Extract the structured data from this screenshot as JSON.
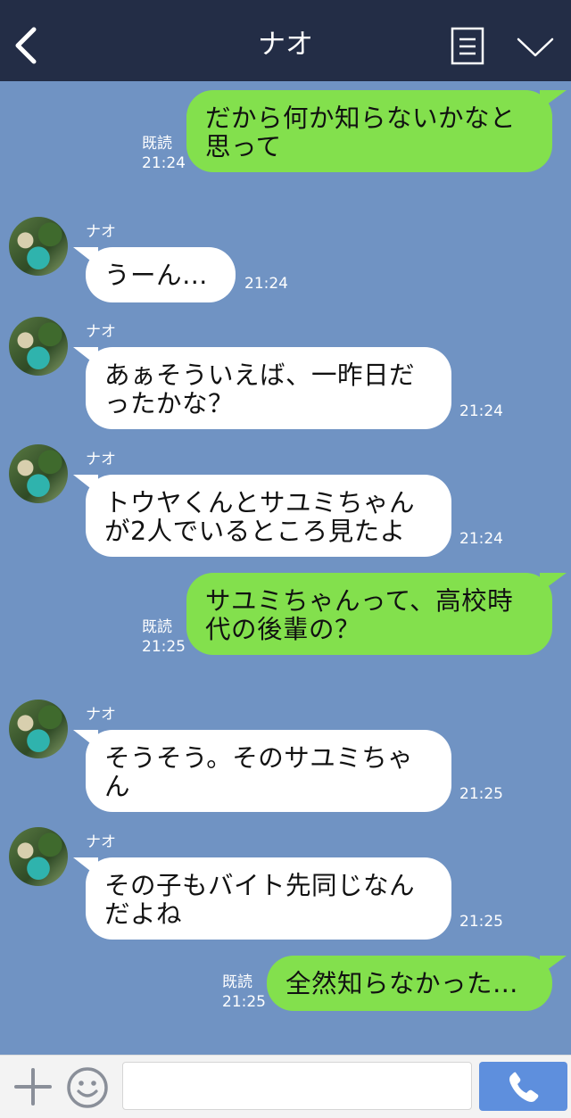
{
  "header": {
    "title": "ナオ",
    "back_icon": "chevron-left-icon",
    "menu_icon": "note-icon",
    "more_icon": "chevron-down-icon"
  },
  "chat": {
    "contact_name": "ナオ",
    "read_label": "既読",
    "messages": [
      {
        "side": "outgoing",
        "lines": [
          "だから何か知らないかなと",
          "思って"
        ],
        "time": "21:24",
        "read": "既読"
      },
      {
        "side": "incoming",
        "sender": "ナオ",
        "lines": [
          "うーん…"
        ],
        "time": "21:24"
      },
      {
        "side": "incoming",
        "sender": "ナオ",
        "lines": [
          "あぁそういえば、一昨日だ",
          "ったかな？"
        ],
        "time": "21:24"
      },
      {
        "side": "incoming",
        "sender": "ナオ",
        "lines": [
          "トウヤくんとサユミちゃん",
          "が2人でいるところ見たよ"
        ],
        "time": "21:24"
      },
      {
        "side": "outgoing",
        "lines": [
          "サユミちゃんって、高校時",
          "代の後輩の？"
        ],
        "time": "21:25",
        "read": "既読"
      },
      {
        "side": "incoming",
        "sender": "ナオ",
        "lines": [
          "そうそう。そのサユミちゃ",
          "ん"
        ],
        "time": "21:25"
      },
      {
        "side": "incoming",
        "sender": "ナオ",
        "lines": [
          "その子もバイト先同じなん",
          "だよね"
        ],
        "time": "21:25"
      },
      {
        "side": "outgoing",
        "lines": [
          "全然知らなかった…"
        ],
        "time": "21:25",
        "read": "既読"
      }
    ]
  },
  "footer": {
    "plus_icon": "plus-icon",
    "emoji_icon": "emoji-icon",
    "input_value": "",
    "call_icon": "phone-icon"
  },
  "colors": {
    "header_bg": "#232d46",
    "chat_bg": "#7093c3",
    "outgoing_bubble": "#83e04d",
    "incoming_bubble": "#ffffff",
    "call_button": "#5e8fdd"
  }
}
